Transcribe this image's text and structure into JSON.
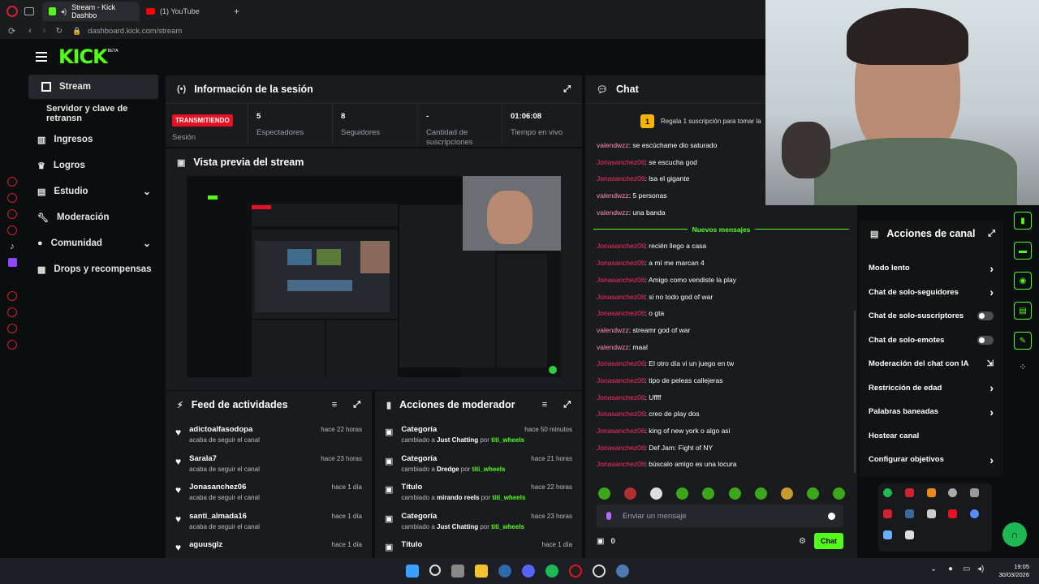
{
  "browser": {
    "tabs": [
      {
        "label": "Stream - Kick Dashbo",
        "active": true
      },
      {
        "label": "(1) YouTube",
        "active": false
      }
    ],
    "new_tab": "+",
    "url_domain": "dashboard.kick.com",
    "url_path": "/stream"
  },
  "header": {
    "logo": "KICK",
    "logo_badge": "BETA"
  },
  "sidebar": {
    "items": [
      {
        "label": "Stream",
        "icon": "broadcast-icon",
        "active": true
      },
      {
        "label": "Servidor y clave de retransn",
        "icon": "",
        "sub": true
      },
      {
        "label": "Ingresos",
        "icon": "chart-icon"
      },
      {
        "label": "Logros",
        "icon": "trophy-icon"
      },
      {
        "label": "Estudio",
        "icon": "studio-icon",
        "expandable": true
      },
      {
        "label": "Moderación",
        "icon": "wrench-icon"
      },
      {
        "label": "Comunidad",
        "icon": "community-icon",
        "expandable": true
      },
      {
        "label": "Drops y recompensas",
        "icon": "drops-icon"
      }
    ]
  },
  "session": {
    "title": "Información de la sesión",
    "status_badge": "TRANSMITIENDO",
    "status_label": "Sesión",
    "stats": [
      {
        "value": "5",
        "label": "Espectadores"
      },
      {
        "value": "8",
        "label": "Seguidores"
      },
      {
        "value": "-",
        "label": "Cantidad de suscripciones"
      },
      {
        "value": "01:06:08",
        "label": "Tiempo en vivo"
      }
    ]
  },
  "preview": {
    "title": "Vista previa del stream"
  },
  "activity_feed": {
    "title": "Feed de actividades",
    "items": [
      {
        "name": "adictoalfasodopa",
        "sub": "acaba de seguir el canal",
        "time": "hace 22 horas"
      },
      {
        "name": "Sarala7",
        "sub": "acaba de seguir el canal",
        "time": "hace 23 horas"
      },
      {
        "name": "Jonasanchez06",
        "sub": "acaba de seguir el canal",
        "time": "hace 1 día"
      },
      {
        "name": "santi_almada16",
        "sub": "acaba de seguir el canal",
        "time": "hace 1 día"
      },
      {
        "name": "aguusglz",
        "sub": "",
        "time": "hace 1 día"
      }
    ]
  },
  "mod_actions": {
    "title": "Acciones de moderador",
    "items": [
      {
        "title": "Categoría",
        "prefix": "cambiado a ",
        "value": "Just Chatting",
        "by": " por ",
        "user": "titi_wheels",
        "time": "hace 50 minutos"
      },
      {
        "title": "Categoría",
        "prefix": "cambiado a ",
        "value": "Dredge",
        "by": " por ",
        "user": "titi_wheels",
        "time": "hace 21 horas"
      },
      {
        "title": "Título",
        "prefix": "cambiado a ",
        "value": "mirando reels",
        "by": " por ",
        "user": "titi_wheels",
        "time": "hace 22 horas"
      },
      {
        "title": "Categoría",
        "prefix": "cambiado a ",
        "value": "Just Chatting",
        "by": " por ",
        "user": "titi_wheels",
        "time": "hace 23 horas"
      },
      {
        "title": "Título",
        "prefix": "",
        "value": "",
        "by": "",
        "user": "",
        "time": "hace 1 día"
      }
    ]
  },
  "chat": {
    "title": "Chat",
    "gift_count": "1",
    "gift_text": "Regala 1 suscripción para tomar la",
    "new_messages_label": "Nuevos mensajes",
    "messages_before": [
      {
        "user": "valendwzz",
        "text": "se escúchame dio saturado",
        "style": "u2"
      },
      {
        "user": "Jonasanchez06",
        "text": "se escucha god",
        "style": "u1"
      },
      {
        "user": "Jonasanchez06",
        "text": "lsa el gigante",
        "style": "u1"
      },
      {
        "user": "valendwzz",
        "text": "5 personas",
        "style": "u2"
      },
      {
        "user": "valendwzz",
        "text": "una banda",
        "style": "u2"
      }
    ],
    "messages_after": [
      {
        "user": "Jonasanchez06",
        "text": "recién llego a casa",
        "style": "u1"
      },
      {
        "user": "Jonasanchez06",
        "text": "a mí me marcan 4",
        "style": "u1"
      },
      {
        "user": "Jonasanchez06",
        "text": "Amigo como vendiste la play",
        "style": "u1"
      },
      {
        "user": "Jonasanchez06",
        "text": "si no todo god of war",
        "style": "u1"
      },
      {
        "user": "Jonasanchez06",
        "text": "o gta",
        "style": "u1"
      },
      {
        "user": "valendwzz",
        "text": "streamr god of war",
        "style": "u2"
      },
      {
        "user": "valendwzz",
        "text": "maal",
        "style": "u2"
      },
      {
        "user": "Jonasanchez06",
        "text": "El otro día vi un juego en tw",
        "style": "u1"
      },
      {
        "user": "Jonasanchez06",
        "text": "tipo de peleas callejeras",
        "style": "u1"
      },
      {
        "user": "Jonasanchez06",
        "text": "Uffff",
        "style": "u1"
      },
      {
        "user": "Jonasanchez06",
        "text": "creo de play dos",
        "style": "u1"
      },
      {
        "user": "Jonasanchez06",
        "text": "king of new york o algo asi",
        "style": "u1"
      },
      {
        "user": "Jonasanchez06",
        "text": "Def Jam: Fight of NY",
        "style": "u1"
      },
      {
        "user": "Jonasanchez06",
        "text": "búscalo amigo es una locura",
        "style": "u1"
      }
    ],
    "input_placeholder": "Enviar un mensaje",
    "points": "0",
    "send_label": "Chat"
  },
  "channel_actions": {
    "title": "Acciones de canal",
    "items": [
      {
        "label": "Modo lento",
        "control": "chevron"
      },
      {
        "label": "Chat de solo-seguidores",
        "control": "chevron"
      },
      {
        "label": "Chat de solo-suscriptores",
        "control": "toggle"
      },
      {
        "label": "Chat de solo-emotes",
        "control": "toggle"
      },
      {
        "label": "Moderación del chat con IA",
        "control": "external"
      },
      {
        "label": "Restricción de edad",
        "control": "chevron"
      },
      {
        "label": "Palabras baneadas",
        "control": "chevron"
      },
      {
        "label": "Hostear canal",
        "control": "none"
      },
      {
        "label": "Configurar objetivos",
        "control": "chevron"
      }
    ]
  },
  "taskbar": {
    "time": "19:05",
    "date": "30/03/2026"
  },
  "colors": {
    "accent": "#53fc18",
    "live_badge": "#e81123",
    "panel": "#191b1f",
    "bg": "#0b0e0f"
  }
}
